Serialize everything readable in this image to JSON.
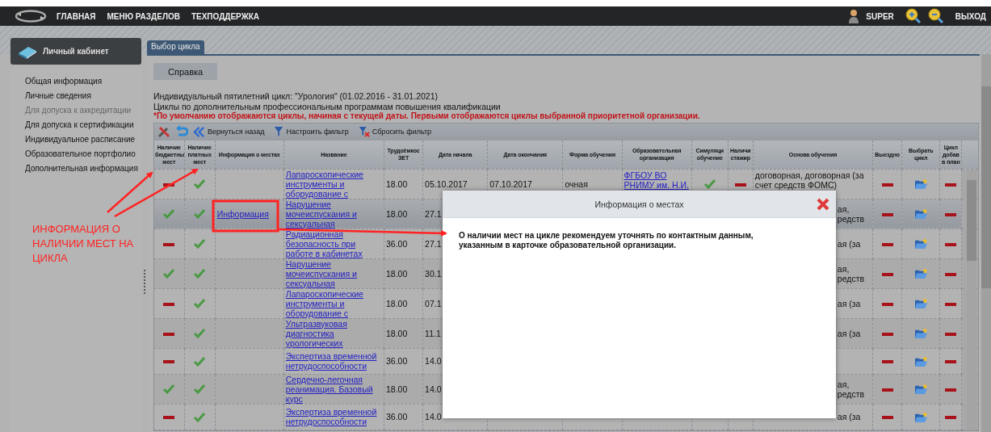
{
  "topbar": {
    "nav": [
      "ГЛАВНАЯ",
      "МЕНЮ РАЗДЕЛОВ",
      "ТЕХПОДДЕРЖКА"
    ],
    "user": "SUPER",
    "logout": "ВЫХОД"
  },
  "sidebar": {
    "title": "Личный кабинет",
    "items": [
      {
        "label": "Общая информация",
        "disabled": false
      },
      {
        "label": "Личные сведения",
        "disabled": false
      },
      {
        "label": "Для допуска к аккредитации",
        "disabled": true
      },
      {
        "label": "Для допуска к сертификации",
        "disabled": false
      },
      {
        "label": "Индивидуальное расписание",
        "disabled": false
      },
      {
        "label": "Образовательное портфолио",
        "disabled": false
      },
      {
        "label": "Дополнительная информация",
        "disabled": false
      }
    ]
  },
  "tabs": [
    {
      "label": "Выбор цикла",
      "selected": true
    }
  ],
  "help_button": "Справка",
  "info_lines": [
    "Индивидуальный пятилетний цикл: \"Урология\" (01.02.2016 - 31.01.2021)",
    "Циклы по дополнительным профессиональным программам повышения квалификации"
  ],
  "notice": "*По умолчанию отображаются циклы, начиная с текущей даты. Первыми отображаются циклы выбранной приоритетной организации.",
  "toolbar": [
    {
      "kind": "tools"
    },
    {
      "kind": "undo"
    },
    {
      "kind": "back",
      "label": "Вернуться назад"
    },
    {
      "kind": "filter",
      "label": "Настроить фильтр"
    },
    {
      "kind": "reset",
      "label": "Сбросить фильтр"
    }
  ],
  "table": {
    "columns": [
      "Наличие бюджетны мест",
      "Наличие платных мест",
      "Информация о местах",
      "Название",
      "Трудоёмкос ЗЕТ",
      "Дата начала",
      "Дата окончания",
      "Форма обучения",
      "Образовательная организация",
      "Симуляци обучение",
      "Наличи стажир",
      "Основа обучения",
      "Выездно",
      "Выбрать цикл",
      "Цикл добав в план"
    ],
    "rows": [
      {
        "selected": false,
        "budget": false,
        "paid": true,
        "name": "Лапароскопические инструменты и оборудование с",
        "hours": "18.00",
        "start": "05.10.2017",
        "end": "07.10.2017",
        "form": "очная",
        "org": "ФГБОУ ВО РНИМУ им. Н.И.",
        "simulation": true,
        "internship": false,
        "basis": "договорная, договорная (за счет средств ФОМС)",
        "onsite": false,
        "in_plan": false
      },
      {
        "selected": true,
        "budget": true,
        "paid": true,
        "info": "Информация",
        "name": "Нарушение мочеиспускания и сексуальная",
        "hours": "18.00",
        "start": "27.1",
        "basis": "ая, редств",
        "onsite": false,
        "in_plan": false
      },
      {
        "selected": false,
        "budget": false,
        "paid": true,
        "name": "Радиационная безопасность при работе в кабинетах",
        "hours": "36.00",
        "start": "27.1",
        "basis": "ая (за",
        "onsite": false,
        "in_plan": false
      },
      {
        "selected": false,
        "budget": true,
        "paid": true,
        "name": "Нарушение мочеиспускания и сексуальная",
        "hours": "18.00",
        "start": "30.1",
        "basis": "ая, редств",
        "onsite": false,
        "in_plan": false
      },
      {
        "selected": false,
        "budget": false,
        "paid": true,
        "name": "Лапароскопические инструменты и оборудование с",
        "hours": "18.00",
        "start": "07.1",
        "basis": "ая (за",
        "onsite": false,
        "in_plan": false
      },
      {
        "selected": false,
        "budget": false,
        "paid": true,
        "name": "Ультразвуковая диагностика урологических",
        "hours": "18.00",
        "start": "11.1",
        "basis": "ая (за",
        "onsite": false,
        "in_plan": false
      },
      {
        "selected": false,
        "budget": false,
        "paid": true,
        "name": "Экспертиза временной нетрудоспособности",
        "hours": "36.00",
        "start": "14.0",
        "onsite": false,
        "in_plan": false
      },
      {
        "selected": false,
        "budget": true,
        "paid": true,
        "name": "Сердечно-легочная реанимация. Базовый курс",
        "hours": "18.00",
        "start": "14.0",
        "basis": "ая, редств",
        "onsite": false,
        "in_plan": false
      },
      {
        "selected": false,
        "budget": false,
        "paid": true,
        "name": "Экспертиза временной нетрудоспособности",
        "hours": "36.00",
        "start": "14.0",
        "basis": "ая (за",
        "onsite": false,
        "in_plan": false
      }
    ]
  },
  "dialog": {
    "title": "Информация о местах",
    "message": "О наличии мест на цикле рекомендуем уточнять по контактным данным, указанным в карточке образовательной организации."
  },
  "annotation": {
    "label": "ИНФОРМАЦИЯ О НАЛИЧИИ МЕСТ НА ЦИКЛА"
  }
}
